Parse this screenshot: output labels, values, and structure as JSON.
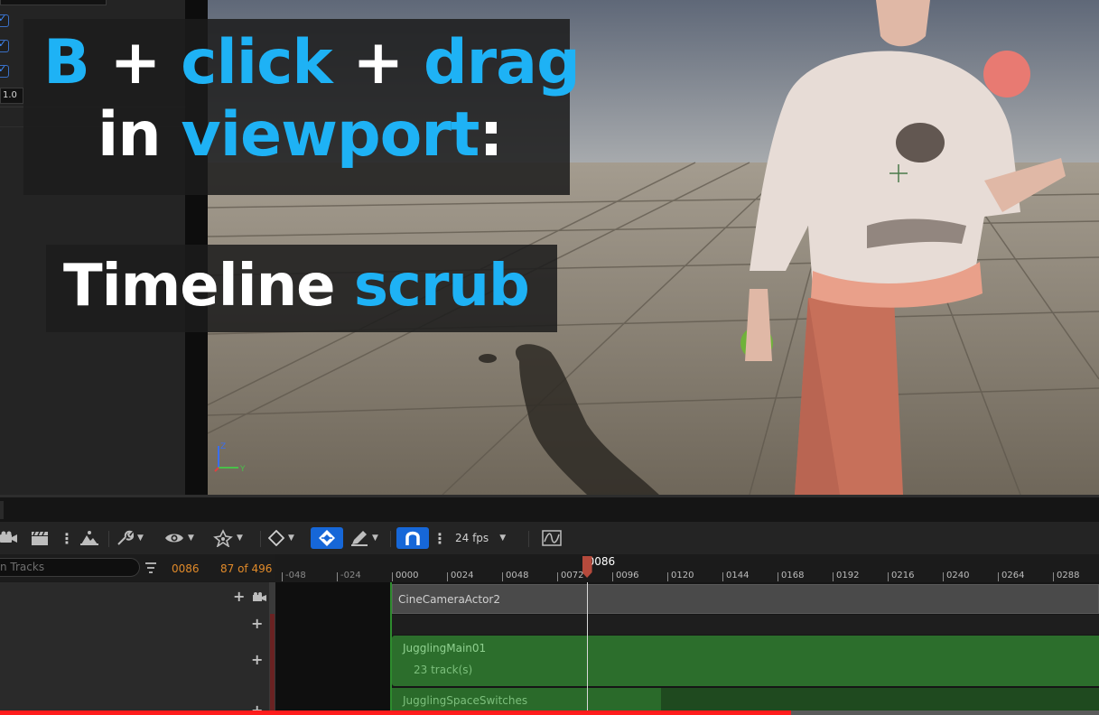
{
  "details_panel": {
    "number_value": "1.0",
    "checkbox_count": 3
  },
  "overlay": {
    "line1": {
      "w1": "B",
      "w2": " + ",
      "w3": "click",
      "w4": " + ",
      "w5": "drag"
    },
    "line2": {
      "w1": "in ",
      "w2": "viewport",
      "w3": ":"
    },
    "line3": {
      "w1": "Timeline ",
      "w2": "scrub"
    },
    "accent_color": "#1eb2f5"
  },
  "viewport": {
    "axis_labels": {
      "z": "Z",
      "y": "Y"
    }
  },
  "toolbar": {
    "icons": [
      "camera-icon",
      "clapperboard-icon",
      "more-options-icon",
      "render-icon",
      "wrench-icon",
      "eye-icon",
      "auto-key-icon",
      "keyframe-icon",
      "snap-transform-icon",
      "pen-icon",
      "magnet-icon",
      "curve-editor-icon"
    ],
    "fps_label": "24 fps"
  },
  "sequencer": {
    "search_placeholder": "n Tracks",
    "current_frame": "0086",
    "frame_count": "87 of 496",
    "playhead_label": "0086",
    "ruler_ticks": [
      "-048",
      "-024",
      "0000",
      "0024",
      "0048",
      "0072",
      "0096",
      "0120",
      "0144",
      "0168",
      "0192",
      "0216",
      "0240",
      "0264",
      "0288"
    ],
    "tracks": {
      "camera": "CineCameraActor2",
      "main": "JugglingMain01",
      "main_sub": "23 track(s)",
      "switches": "JugglingSpaceSwitches"
    }
  },
  "video_progress": 0.72
}
